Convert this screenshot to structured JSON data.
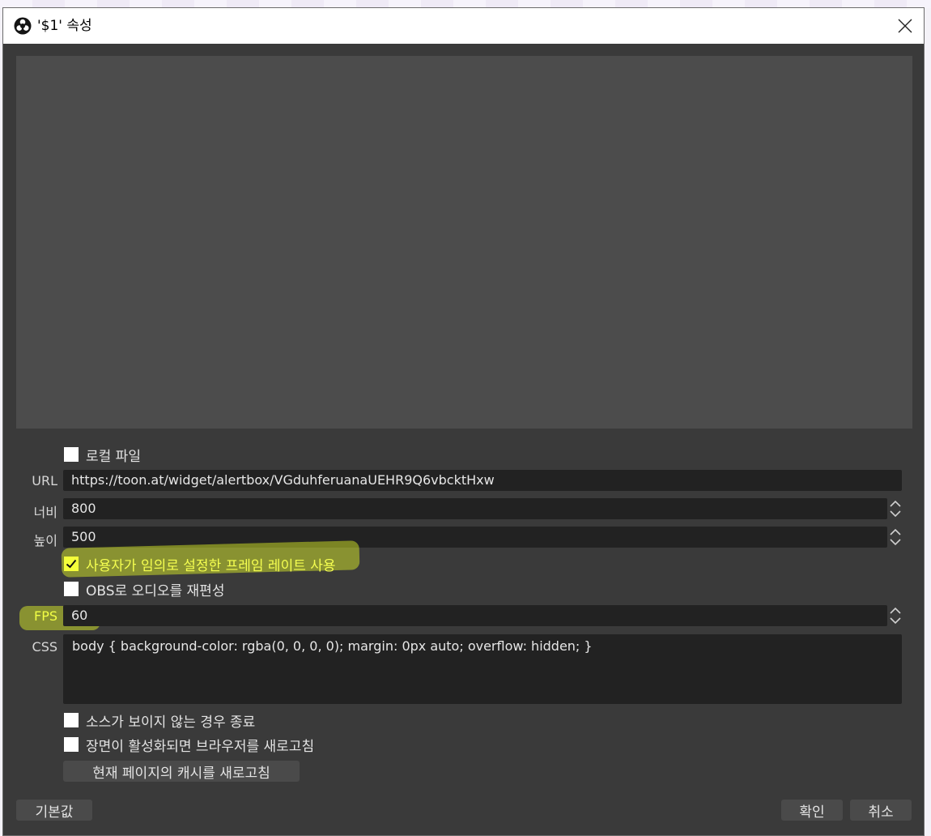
{
  "window": {
    "title": "'$1' 속성"
  },
  "form": {
    "local_file_label": "로컬 파일",
    "url_label": "URL",
    "url_value": "https://toon.at/widget/alertbox/VGduhferuanaUEHR9Q6vbcktHxw",
    "width_label": "너비",
    "width_value": "800",
    "height_label": "높이",
    "height_value": "500",
    "custom_fps_label": "사용자가 임의로 설정한 프레임 레이트 사용",
    "custom_fps_checked": true,
    "obs_audio_label": "OBS로 오디오를 재편성",
    "fps_label": "FPS",
    "fps_value": "60",
    "css_label": "CSS",
    "css_value": "body { background-color: rgba(0, 0, 0, 0); margin: 0px auto; overflow: hidden; }",
    "shutdown_label": "소스가 보이지 않는 경우 종료",
    "refresh_on_scene_label": "장면이 활성화되면 브라우저를 새로고침",
    "refresh_cache_button": "현재 페이지의 캐시를 새로고침"
  },
  "footer": {
    "defaults_button": "기본값",
    "ok_button": "확인",
    "cancel_button": "취소"
  },
  "colors": {
    "dialog_bg": "#3a3a3a",
    "field_bg": "#222222",
    "highlight": "#ecff28"
  }
}
